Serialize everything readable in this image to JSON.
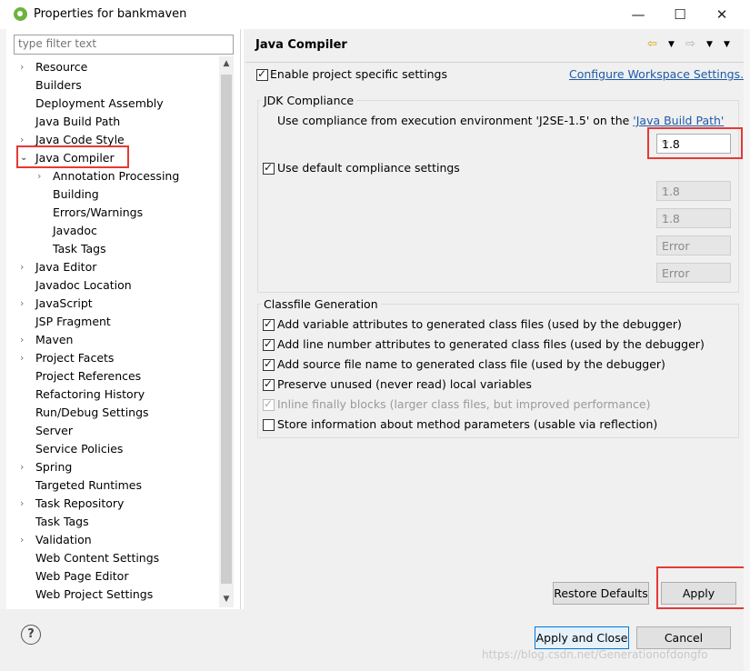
{
  "window": {
    "title": "Properties for bankmaven",
    "minimize": "—",
    "maximize": "☐",
    "close": "✕"
  },
  "filter": {
    "placeholder": "type filter text"
  },
  "tree": {
    "items": [
      {
        "label": "Resource",
        "arrow": "›"
      },
      {
        "label": "Builders",
        "arrow": ""
      },
      {
        "label": "Deployment Assembly",
        "arrow": ""
      },
      {
        "label": "Java Build Path",
        "arrow": ""
      },
      {
        "label": "Java Code Style",
        "arrow": "›"
      },
      {
        "label": "Java Compiler",
        "arrow": "⌄"
      },
      {
        "label": "Annotation Processing",
        "arrow": "›"
      },
      {
        "label": "Building",
        "arrow": ""
      },
      {
        "label": "Errors/Warnings",
        "arrow": ""
      },
      {
        "label": "Javadoc",
        "arrow": ""
      },
      {
        "label": "Task Tags",
        "arrow": ""
      },
      {
        "label": "Java Editor",
        "arrow": "›"
      },
      {
        "label": "Javadoc Location",
        "arrow": ""
      },
      {
        "label": "JavaScript",
        "arrow": "›"
      },
      {
        "label": "JSP Fragment",
        "arrow": ""
      },
      {
        "label": "Maven",
        "arrow": "›"
      },
      {
        "label": "Project Facets",
        "arrow": "›"
      },
      {
        "label": "Project References",
        "arrow": ""
      },
      {
        "label": "Refactoring History",
        "arrow": ""
      },
      {
        "label": "Run/Debug Settings",
        "arrow": ""
      },
      {
        "label": "Server",
        "arrow": ""
      },
      {
        "label": "Service Policies",
        "arrow": ""
      },
      {
        "label": "Spring",
        "arrow": "›"
      },
      {
        "label": "Targeted Runtimes",
        "arrow": ""
      },
      {
        "label": "Task Repository",
        "arrow": "›"
      },
      {
        "label": "Task Tags",
        "arrow": ""
      },
      {
        "label": "Validation",
        "arrow": "›"
      },
      {
        "label": "Web Content Settings",
        "arrow": ""
      },
      {
        "label": "Web Page Editor",
        "arrow": ""
      },
      {
        "label": "Web Project Settings",
        "arrow": ""
      }
    ]
  },
  "page": {
    "title": "Java Compiler",
    "enable_specific": "Enable project specific settings",
    "configure_link": "Configure Workspace Settings...",
    "jdk_group": "JDK Compliance",
    "use_compliance_pre": "Use compliance from execution environment 'J2SE-1.5' on the ",
    "use_compliance_link": "'Java Build Path'",
    "compliance_value": "1.8",
    "use_default": "Use default compliance settings",
    "combos": [
      "1.8",
      "1.8",
      "Error",
      "Error"
    ],
    "classfile_group": "Classfile Generation",
    "options": [
      {
        "label": "Add variable attributes to generated class files (used by the debugger)",
        "checked": true,
        "disabled": false
      },
      {
        "label": "Add line number attributes to generated class files (used by the debugger)",
        "checked": true,
        "disabled": false
      },
      {
        "label": "Add source file name to generated class file (used by the debugger)",
        "checked": true,
        "disabled": false
      },
      {
        "label": "Preserve unused (never read) local variables",
        "checked": true,
        "disabled": false
      },
      {
        "label": "Inline finally blocks (larger class files, but improved performance)",
        "checked": true,
        "disabled": true
      },
      {
        "label": "Store information about method parameters (usable via reflection)",
        "checked": false,
        "disabled": false
      }
    ],
    "restore_defaults": "Restore Defaults",
    "apply": "Apply"
  },
  "footer": {
    "help": "?",
    "apply_close": "Apply and Close",
    "cancel": "Cancel",
    "watermark": "https://blog.csdn.net/Generationofdongfo"
  },
  "colors": {
    "highlight": "#e53935",
    "link": "#1e5aa8",
    "default_button": "#0078d7"
  }
}
